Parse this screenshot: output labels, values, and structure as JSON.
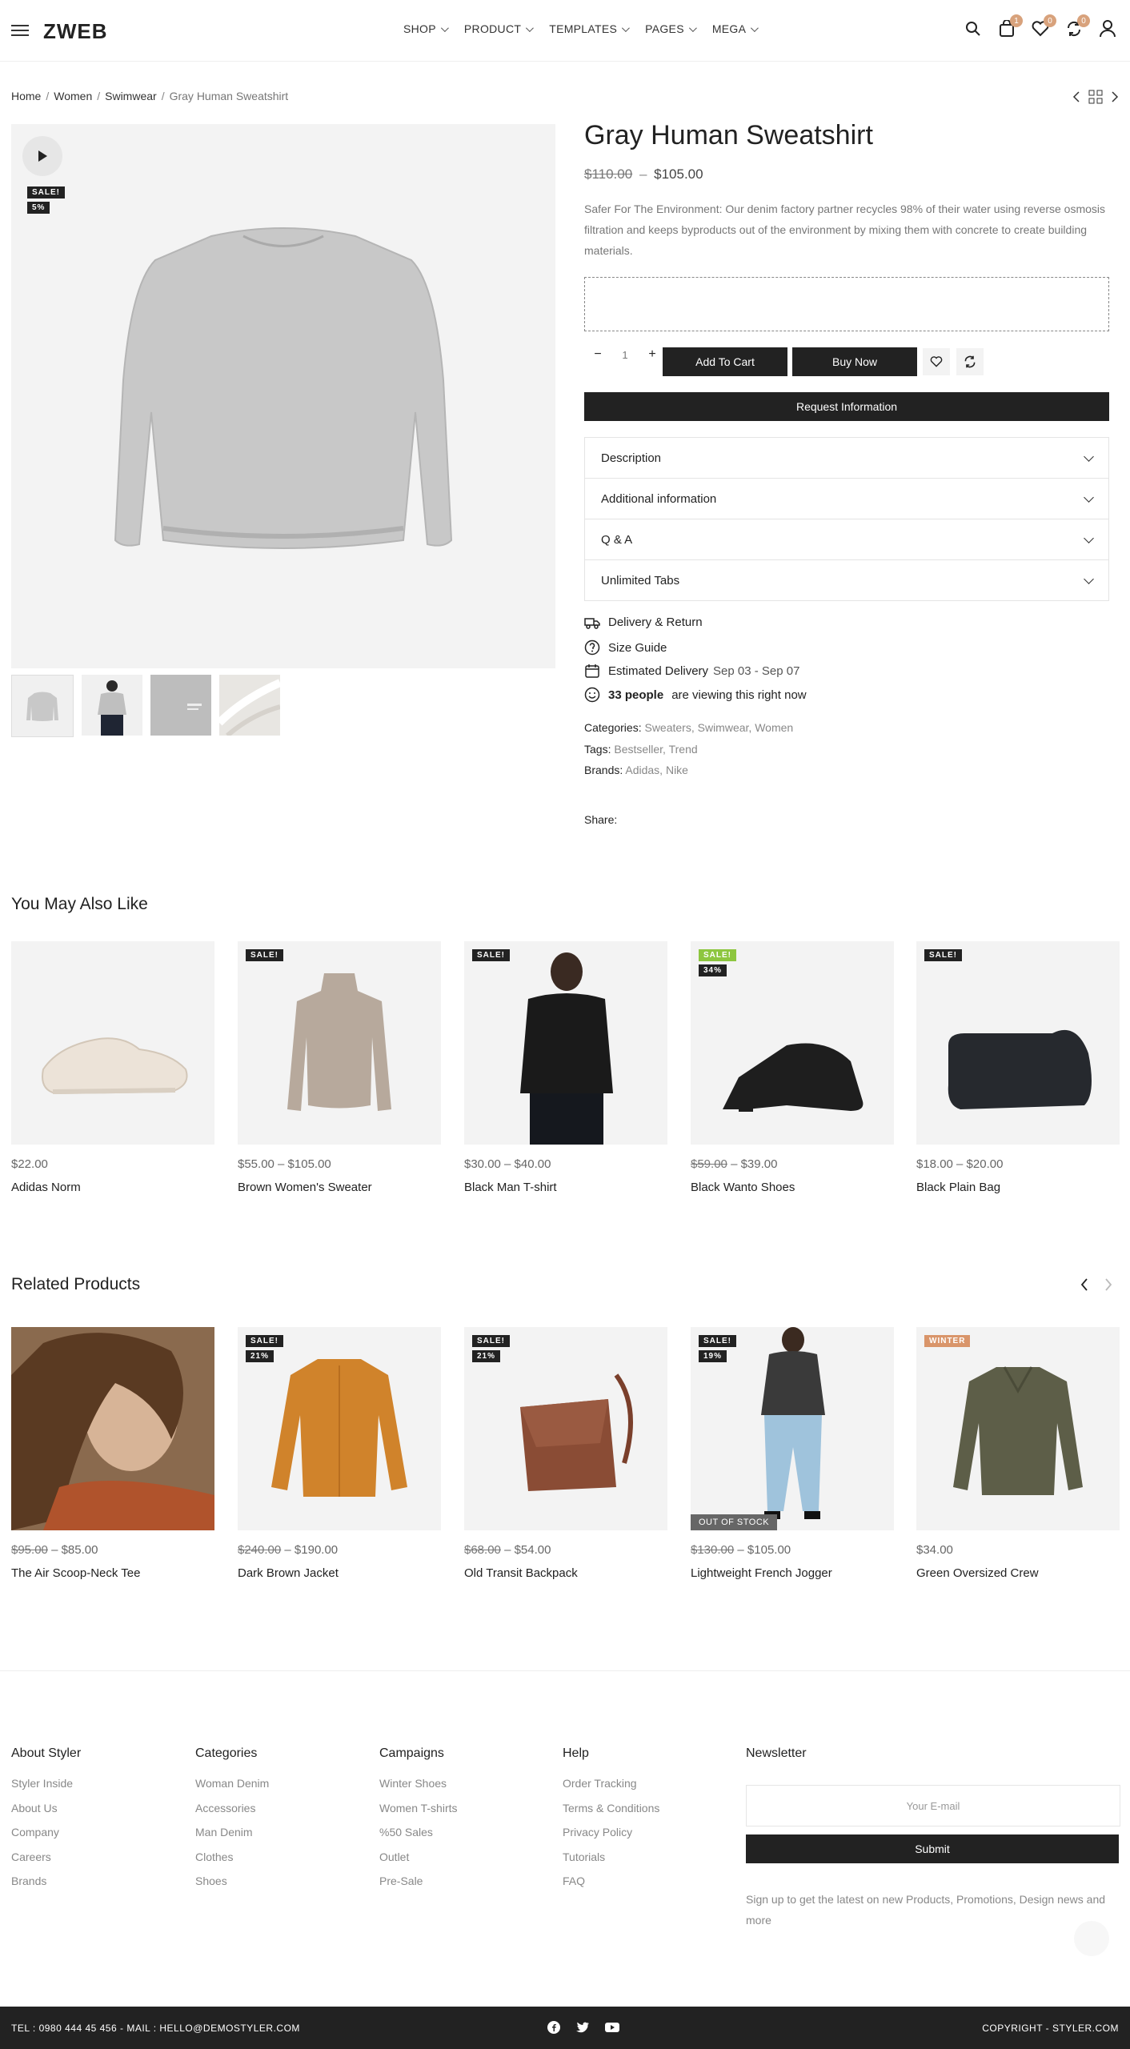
{
  "header": {
    "logo": "ZWEB",
    "nav": [
      {
        "label": "SHOP"
      },
      {
        "label": "PRODUCT"
      },
      {
        "label": "TEMPLATES"
      },
      {
        "label": "PAGES"
      },
      {
        "label": "MEGA"
      }
    ],
    "cart_count": "1",
    "wishlist_count": "0",
    "compare_count": "0"
  },
  "breadcrumb": {
    "home": "Home",
    "women": "Women",
    "swimwear": "Swimwear",
    "current": "Gray Human Sweatshirt"
  },
  "gallery": {
    "badge_sale": "SALE!",
    "badge_pct": "5%"
  },
  "product": {
    "title": "Gray Human Sweatshirt",
    "price_old": "$110.00",
    "price_sep": "–",
    "price_new": "$105.00",
    "description": "Safer For The Environment: Our denim factory partner recycles 98% of their water using reverse osmosis filtration and keeps byproducts out of the environment by mixing them with concrete to create building materials.",
    "qty_minus": "−",
    "qty_value": "1",
    "qty_plus": "+",
    "add_to_cart": "Add To Cart",
    "buy_now": "Buy Now",
    "request_info": "Request Information",
    "tabs": [
      {
        "label": "Description"
      },
      {
        "label": "Additional information"
      },
      {
        "label": "Q & A"
      },
      {
        "label": "Unlimited Tabs"
      }
    ],
    "delivery_return": "Delivery & Return",
    "size_guide": "Size Guide",
    "est_delivery_label": "Estimated Delivery",
    "est_delivery_value": "Sep 03 - Sep 07",
    "viewers_count": "33 people",
    "viewers_text": "are viewing this right now",
    "categories_label": "Categories:",
    "categories": "Sweaters, Swimwear, Women",
    "tags_label": "Tags:",
    "tags": "Bestseller, Trend",
    "brands_label": "Brands:",
    "brands": "Adidas, Nike",
    "share_label": "Share:"
  },
  "also_like": {
    "title": "You May Also Like",
    "items": [
      {
        "price": "$22.00",
        "name": "Adidas Norm"
      },
      {
        "price": "$55.00 – $105.00",
        "name": "Brown Women's Sweater",
        "badge": "SALE!"
      },
      {
        "price": "$30.00 – $40.00",
        "name": "Black Man T-shirt",
        "badge": "SALE!"
      },
      {
        "price_old": "$59.00",
        "price_new": "– $39.00",
        "name": "Black Wanto Shoes",
        "badge": "SALE!",
        "pct": "34%"
      },
      {
        "price": "$18.00 – $20.00",
        "name": "Black Plain Bag",
        "badge": "SALE!"
      }
    ]
  },
  "related": {
    "title": "Related Products",
    "items": [
      {
        "price_old": "$95.00",
        "price_new": "– $85.00",
        "name": "The Air Scoop-Neck Tee"
      },
      {
        "price_old": "$240.00",
        "price_new": "– $190.00",
        "name": "Dark Brown Jacket",
        "badge": "SALE!",
        "pct": "21%"
      },
      {
        "price_old": "$68.00",
        "price_new": "– $54.00",
        "name": "Old Transit Backpack",
        "badge": "SALE!",
        "pct": "21%"
      },
      {
        "price_old": "$130.00",
        "price_new": "– $105.00",
        "name": "Lightweight French Jogger",
        "badge": "SALE!",
        "pct": "19%",
        "oos": "OUT OF STOCK"
      },
      {
        "price": "$34.00",
        "name": "Green Oversized Crew",
        "badge": "WINTER"
      }
    ]
  },
  "footer": {
    "about": {
      "title": "About Styler",
      "links": [
        "Styler Inside",
        "About Us",
        "Company",
        "Careers",
        "Brands"
      ]
    },
    "categories": {
      "title": "Categories",
      "links": [
        "Woman Denim",
        "Accessories",
        "Man Denim",
        "Clothes",
        "Shoes"
      ]
    },
    "campaigns": {
      "title": "Campaigns",
      "links": [
        "Winter Shoes",
        "Women T-shirts",
        "%50 Sales",
        "Outlet",
        "Pre-Sale"
      ]
    },
    "help": {
      "title": "Help",
      "links": [
        "Order Tracking",
        "Terms & Conditions",
        "Privacy Policy",
        "Tutorials",
        "FAQ"
      ]
    },
    "newsletter": {
      "title": "Newsletter",
      "placeholder": "Your E-mail",
      "submit": "Submit",
      "text": "Sign up to get the latest on new Products, Promotions, Design news and more"
    },
    "contact": "TEL : 0980 444 45 456  -  MAIL : HELLO@DEMOSTYLER.COM",
    "copyright": "COPYRIGHT - STYLER.COM"
  },
  "colors": {
    "accent": "#d8a27c",
    "dark": "#222222",
    "green_badge": "#8dc63f",
    "orange_badge": "#d9956a"
  }
}
